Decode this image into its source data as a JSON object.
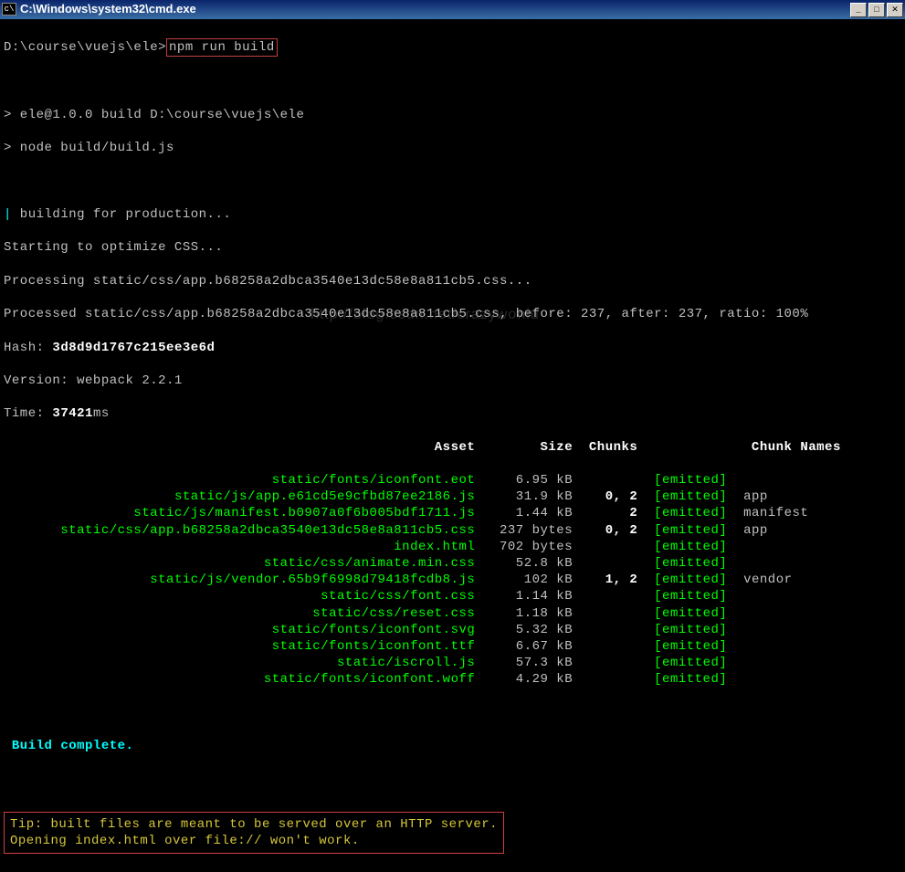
{
  "titlebar": {
    "title": "C:\\Windows\\system32\\cmd.exe"
  },
  "prompt": {
    "path": "D:\\course\\vuejs\\ele>",
    "command": "npm run build"
  },
  "npm": {
    "line1": "> ele@1.0.0 build D:\\course\\vuejs\\ele",
    "line2": "> node build/build.js"
  },
  "build": {
    "pipe": "|",
    "building": " building for production...",
    "optimize": "Starting to optimize CSS...",
    "processing": "Processing static/css/app.b68258a2dbca3540e13dc58e8a811cb5.css...",
    "processed": "Processed static/css/app.b68258a2dbca3540e13dc58e8a811cb5.css, before: 237, after: 237, ratio: 100%",
    "hash_label": "Hash: ",
    "hash_value": "3d8d9d1767c215ee3e6d",
    "version_label": "Version: webpack ",
    "version_value": "2.2.1",
    "time_label": "Time: ",
    "time_value": "37421",
    "time_suffix": "ms"
  },
  "table": {
    "headers": {
      "asset": "Asset",
      "size": "Size",
      "chunks": "Chunks",
      "chunk_names": "Chunk Names"
    },
    "rows": [
      {
        "asset": "static/fonts/iconfont.eot",
        "size": "6.95 kB",
        "chunks": "",
        "emitted": "[emitted]",
        "name": ""
      },
      {
        "asset": "static/js/app.e61cd5e9cfbd87ee2186.js",
        "size": "31.9 kB",
        "chunks": "0, 2",
        "emitted": "[emitted]",
        "name": "app"
      },
      {
        "asset": "static/js/manifest.b0907a0f6b005bdf1711.js",
        "size": "1.44 kB",
        "chunks": "2",
        "emitted": "[emitted]",
        "name": "manifest"
      },
      {
        "asset": "static/css/app.b68258a2dbca3540e13dc58e8a811cb5.css",
        "size": "237 bytes",
        "chunks": "0, 2",
        "emitted": "[emitted]",
        "name": "app"
      },
      {
        "asset": "index.html",
        "size": "702 bytes",
        "chunks": "",
        "emitted": "[emitted]",
        "name": ""
      },
      {
        "asset": "static/css/animate.min.css",
        "size": "52.8 kB",
        "chunks": "",
        "emitted": "[emitted]",
        "name": ""
      },
      {
        "asset": "static/js/vendor.65b9f6998d79418fcdb8.js",
        "size": "102 kB",
        "chunks": "1, 2",
        "emitted": "[emitted]",
        "name": "vendor"
      },
      {
        "asset": "static/css/font.css",
        "size": "1.14 kB",
        "chunks": "",
        "emitted": "[emitted]",
        "name": ""
      },
      {
        "asset": "static/css/reset.css",
        "size": "1.18 kB",
        "chunks": "",
        "emitted": "[emitted]",
        "name": ""
      },
      {
        "asset": "static/fonts/iconfont.svg",
        "size": "5.32 kB",
        "chunks": "",
        "emitted": "[emitted]",
        "name": ""
      },
      {
        "asset": "static/fonts/iconfont.ttf",
        "size": "6.67 kB",
        "chunks": "",
        "emitted": "[emitted]",
        "name": ""
      },
      {
        "asset": "static/iscroll.js",
        "size": "57.3 kB",
        "chunks": "",
        "emitted": "[emitted]",
        "name": ""
      },
      {
        "asset": "static/fonts/iconfont.woff",
        "size": "4.29 kB",
        "chunks": "",
        "emitted": "[emitted]",
        "name": ""
      }
    ]
  },
  "complete": "Build complete.",
  "tip": {
    "line1": "Tip: built files are meant to be served over an HTTP server.",
    "line2": "Opening index.html over file:// won't work."
  },
  "watermark": "http://blog.csdn.net/crazywoniu"
}
